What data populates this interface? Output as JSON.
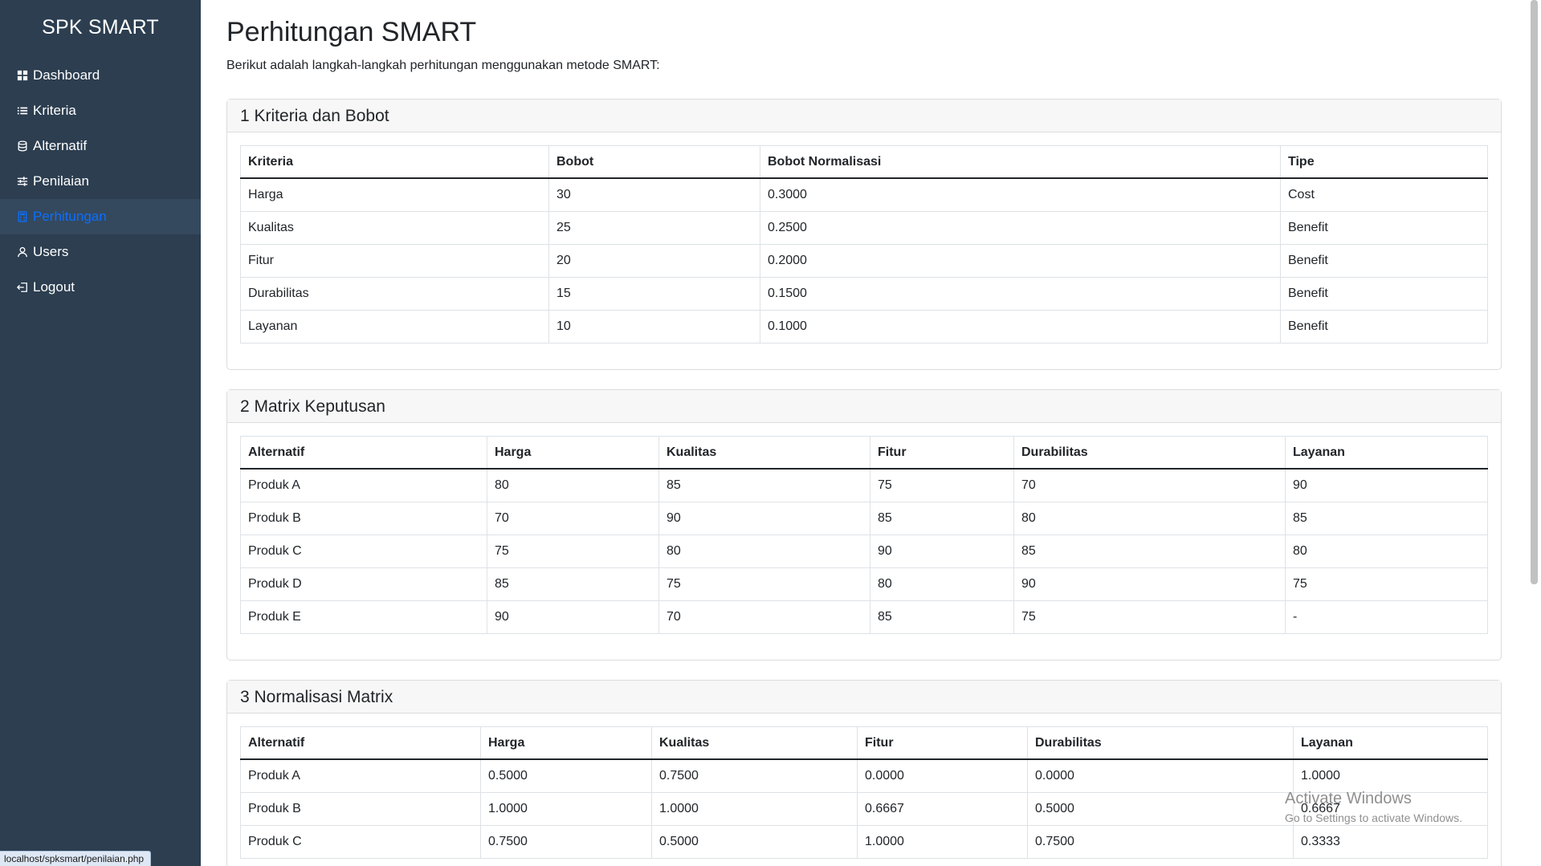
{
  "sidebar": {
    "brand": "SPK SMART",
    "items": [
      {
        "label": "Dashboard",
        "icon": "grid-icon",
        "active": false
      },
      {
        "label": "Kriteria",
        "icon": "list-icon",
        "active": false
      },
      {
        "label": "Alternatif",
        "icon": "database-icon",
        "active": false
      },
      {
        "label": "Penilaian",
        "icon": "sliders-icon",
        "active": false
      },
      {
        "label": "Perhitungan",
        "icon": "calculator-icon",
        "active": true
      },
      {
        "label": "Users",
        "icon": "user-icon",
        "active": false
      },
      {
        "label": "Logout",
        "icon": "logout-icon",
        "active": false
      }
    ],
    "active_color": "#0d6efd",
    "background": "#2c3e50"
  },
  "page": {
    "title": "Perhitungan SMART",
    "description": "Berikut adalah langkah-langkah perhitungan menggunakan metode SMART:"
  },
  "sections": [
    {
      "title": "1 Kriteria dan Bobot",
      "headers": [
        "Kriteria",
        "Bobot",
        "Bobot Normalisasi",
        "Tipe"
      ],
      "rows": [
        [
          "Harga",
          "30",
          "0.3000",
          "Cost"
        ],
        [
          "Kualitas",
          "25",
          "0.2500",
          "Benefit"
        ],
        [
          "Fitur",
          "20",
          "0.2000",
          "Benefit"
        ],
        [
          "Durabilitas",
          "15",
          "0.1500",
          "Benefit"
        ],
        [
          "Layanan",
          "10",
          "0.1000",
          "Benefit"
        ]
      ]
    },
    {
      "title": "2 Matrix Keputusan",
      "headers": [
        "Alternatif",
        "Harga",
        "Kualitas",
        "Fitur",
        "Durabilitas",
        "Layanan"
      ],
      "rows": [
        [
          "Produk A",
          "80",
          "85",
          "75",
          "70",
          "90"
        ],
        [
          "Produk B",
          "70",
          "90",
          "85",
          "80",
          "85"
        ],
        [
          "Produk C",
          "75",
          "80",
          "90",
          "85",
          "80"
        ],
        [
          "Produk D",
          "85",
          "75",
          "80",
          "90",
          "75"
        ],
        [
          "Produk E",
          "90",
          "70",
          "85",
          "75",
          "-"
        ]
      ]
    },
    {
      "title": "3 Normalisasi Matrix",
      "headers": [
        "Alternatif",
        "Harga",
        "Kualitas",
        "Fitur",
        "Durabilitas",
        "Layanan"
      ],
      "rows": [
        [
          "Produk A",
          "0.5000",
          "0.7500",
          "0.0000",
          "0.0000",
          "1.0000"
        ],
        [
          "Produk B",
          "1.0000",
          "1.0000",
          "0.6667",
          "0.5000",
          "0.6667"
        ],
        [
          "Produk C",
          "0.7500",
          "0.5000",
          "1.0000",
          "0.7500",
          "0.3333"
        ]
      ]
    }
  ],
  "status_bar": {
    "url": "localhost/spksmart/penilaian.php"
  },
  "watermark": {
    "title": "Activate Windows",
    "subtitle": "Go to Settings to activate Windows."
  }
}
